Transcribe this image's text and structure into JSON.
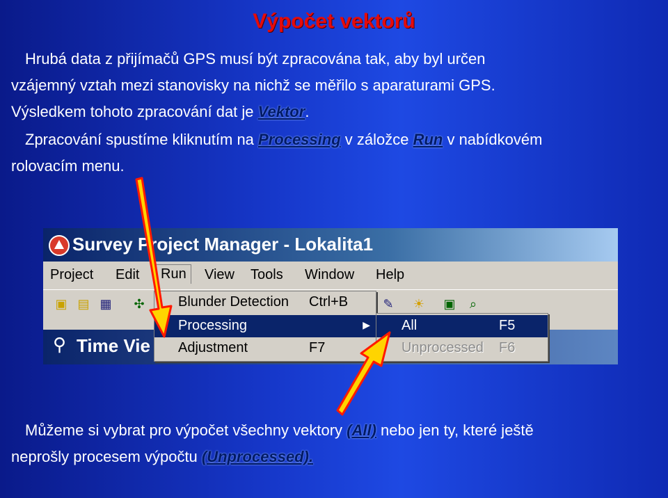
{
  "slide": {
    "title": "Výpočet vektorů",
    "p1": {
      "line1": "Hrubá data z přijímačů GPS musí být zpracována tak, aby byl určen",
      "line2": "vzájemný vztah mezi stanovisky na nichž se měřilo s aparaturami GPS.",
      "line3_pre": "Výsledkem tohoto zpracování dat je ",
      "line3_hl": "Vektor",
      "line3_post": "."
    },
    "p2": {
      "pre": "Zpracování spustíme kliknutím na ",
      "hl1": "Processing",
      "mid": " v záložce ",
      "hl2": "Run",
      "post": " v nabídkovém",
      "line2": "rolovacím menu."
    },
    "p3": {
      "pre": "Můžeme si vybrat pro výpočet všechny vektory ",
      "hl1": "(All)",
      "mid": " nebo jen ty, které ještě",
      "line2_pre": "neprošly procesem výpočtu ",
      "hl2": "(Unprocessed)."
    }
  },
  "app": {
    "window_title": "Survey Project Manager - Lokalita1",
    "doc_title": "Time Vie",
    "menu": [
      "Project",
      "Edit",
      "Run",
      "View",
      "Tools",
      "Window",
      "Help"
    ],
    "run_menu": [
      {
        "label": "Blunder Detection",
        "shortcut": "Ctrl+B"
      },
      {
        "label": "Processing",
        "shortcut": ""
      },
      {
        "label": "Adjustment",
        "shortcut": "F7"
      }
    ],
    "processing_submenu": [
      {
        "label": "All",
        "shortcut": "F5"
      },
      {
        "label": "Unprocessed",
        "shortcut": "F6"
      }
    ],
    "icons": [
      "new-icon",
      "open-icon",
      "save-icon",
      "network-icon",
      "tool-icon",
      "sun-icon",
      "point-icon",
      "zoom-icon"
    ]
  },
  "colors": {
    "title": "#e50b0b",
    "highlight": "#001a66",
    "arrow": "#ff1a00",
    "arrow_fill": "#ffd400",
    "selection": "#0a246a"
  }
}
